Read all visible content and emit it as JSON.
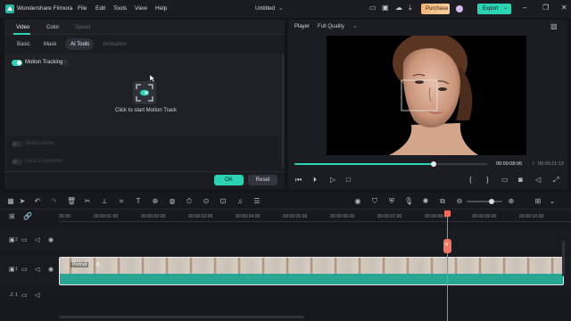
{
  "titlebar": {
    "app_name": "Wondershare Filmora",
    "menu": [
      "File",
      "Edit",
      "Tools",
      "View",
      "Help"
    ],
    "project_title": "Untitled",
    "purchase_label": "Purchase",
    "export_label": "Export"
  },
  "left_panel": {
    "tabs": [
      "Video",
      "Color",
      "Speed"
    ],
    "sub_tabs": [
      "Basic",
      "Mask",
      "AI Tools",
      "Animation"
    ],
    "motion_tracking_label": "Motion Tracking",
    "motion_tracking_on": true,
    "track_hint": "Click to start Motion Track",
    "stabilization_label": "Stabilization",
    "lens_correction_label": "Lens Correction",
    "ok_label": "OK",
    "reset_label": "Reset"
  },
  "player": {
    "label": "Player",
    "quality": "Full Quality",
    "current_time": "00:00:08:06",
    "separator": "/",
    "total_time": "00:00:11:13",
    "progress": 0.72
  },
  "timeline": {
    "ruler": [
      "00:00",
      "00:00:01:00",
      "00:00:02:00",
      "00:00:03:00",
      "00:00:04:00",
      "00:00:05:00",
      "00:00:06:00",
      "00:00:07:00",
      "00:00:08:00",
      "00:00:09:00",
      "00:00:10:00"
    ],
    "clip_name": "Portrait",
    "tracks": [
      {
        "number": "2"
      },
      {
        "number": "1"
      },
      {
        "number": "1"
      }
    ]
  },
  "colors": {
    "accent": "#2bd3b4",
    "purchase": "#e0a15a",
    "playhead": "#f26b5b"
  }
}
